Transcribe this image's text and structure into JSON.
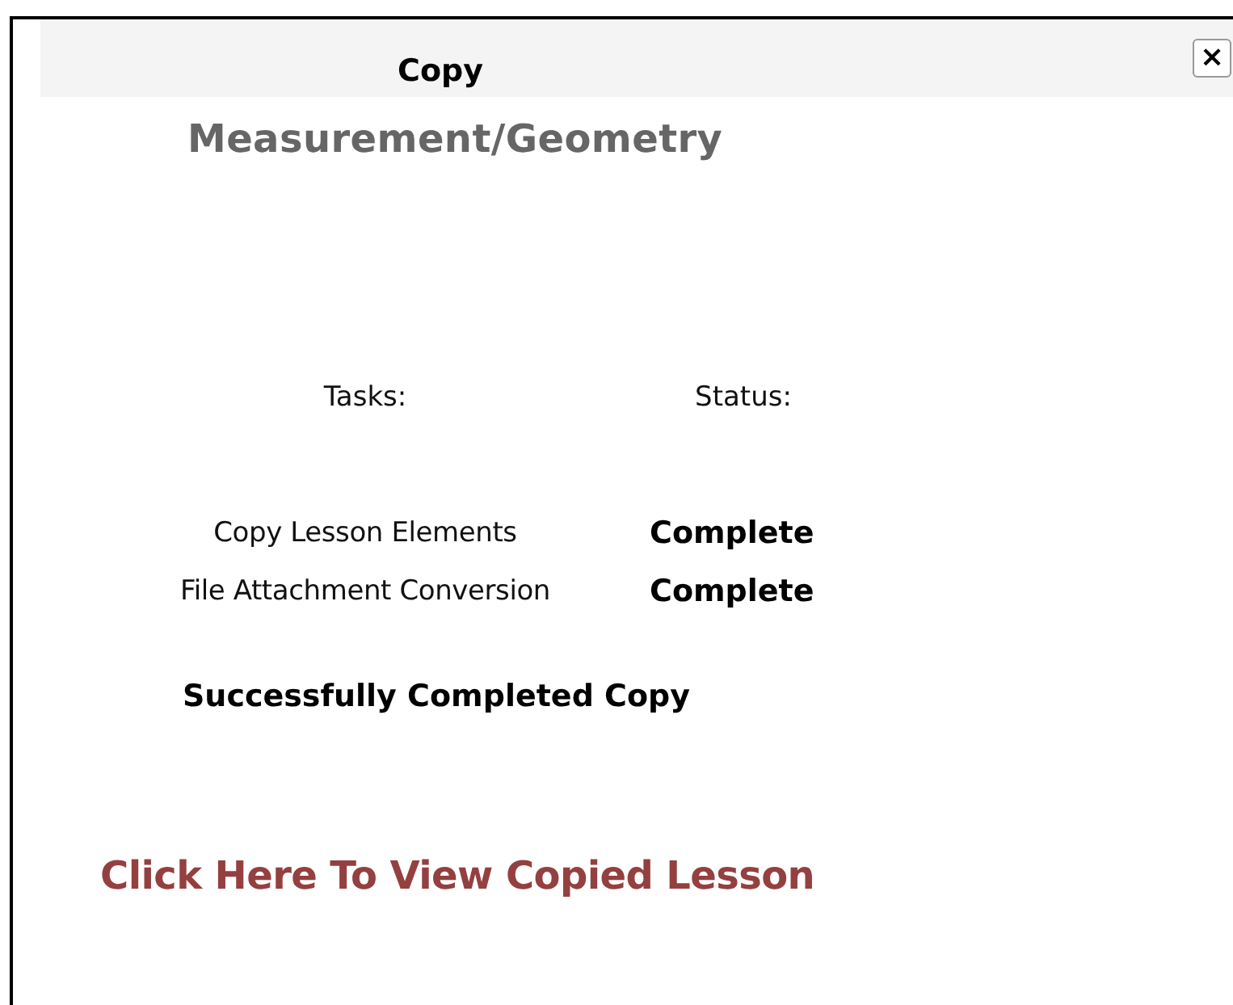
{
  "dialog": {
    "title": "Copy",
    "close_label": "×"
  },
  "lesson_title": "Measurement/Geometry",
  "columns": [
    "Tasks:",
    "Status:"
  ],
  "tasks": [
    {
      "name": "Copy Lesson Elements",
      "status": "Complete"
    },
    {
      "name": "File Attachment Conversion",
      "status": "Complete"
    }
  ],
  "message": "Successfully Completed Copy",
  "link": "Click Here To View Copied Lesson"
}
